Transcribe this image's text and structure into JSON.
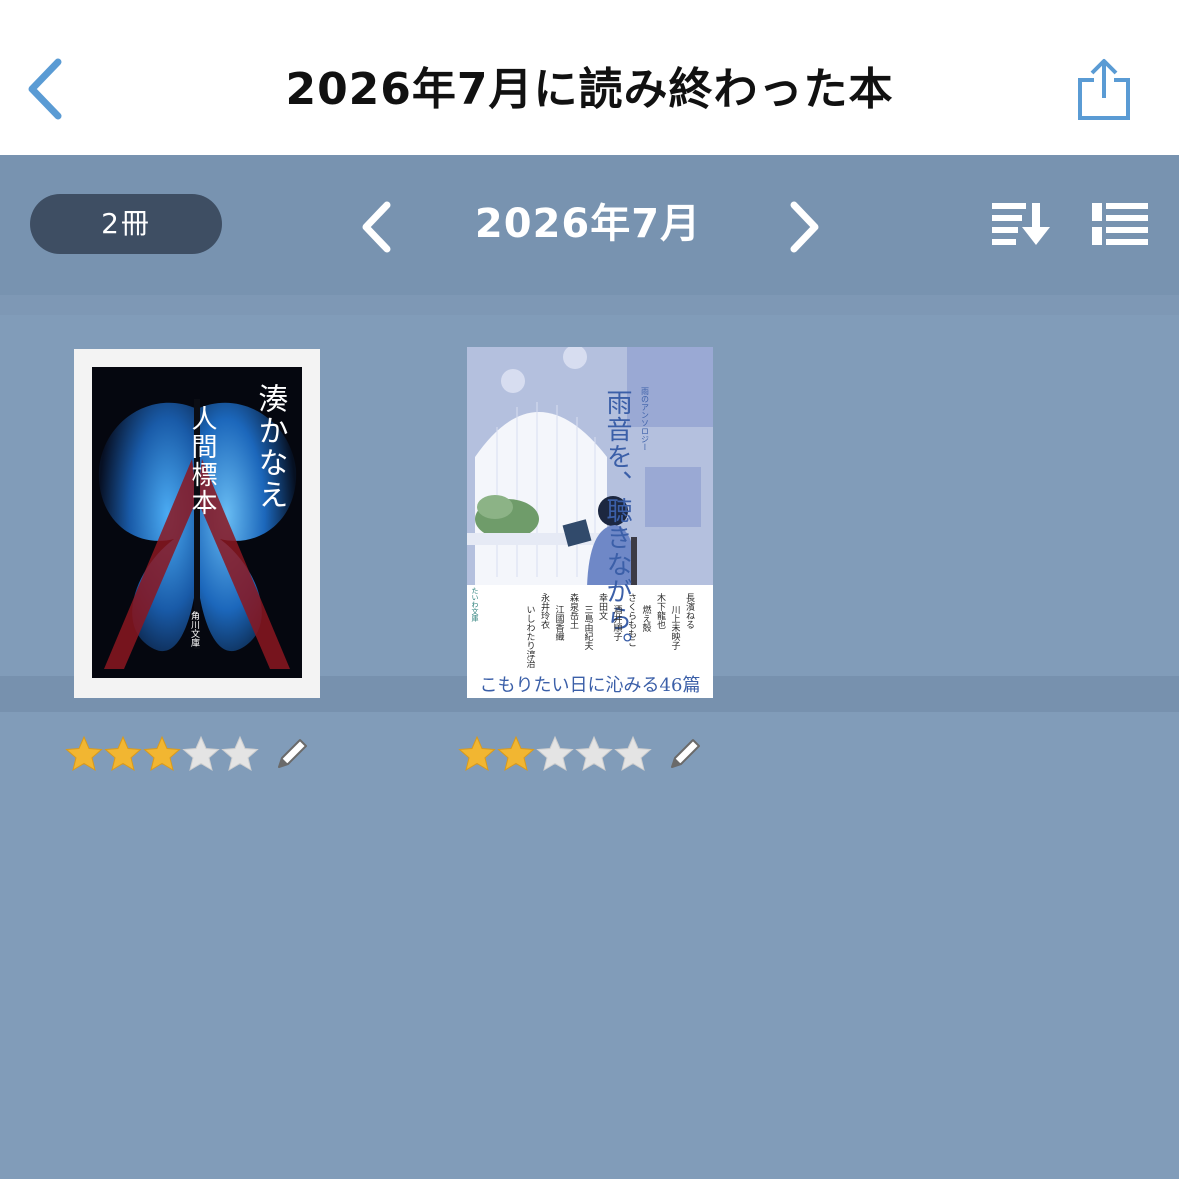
{
  "nav": {
    "title": "2026年7月に読み終わった本",
    "back_icon": "chevron-left-icon",
    "share_icon": "share-icon",
    "accent_color": "#5a9bd4"
  },
  "toolbar": {
    "count_label": "2冊",
    "month_label": "2026年7月",
    "prev_icon": "chevron-left-icon",
    "next_icon": "chevron-right-icon",
    "sort_icon": "sort-descending-icon",
    "view_icon": "list-view-icon"
  },
  "books": [
    {
      "author": "湊かなえ",
      "title": "人間標本",
      "publisher": "角川文庫",
      "rating": 3,
      "max_rating": 5
    },
    {
      "title": "雨音を、聴きながら。",
      "series": "雨のアンソロジー",
      "label": "たいわ文庫",
      "tagline": "こもりたい日に沁みる46篇",
      "authors": [
        "長濱ねる",
        "川上未映子",
        "木下龍也",
        "燃え殻",
        "さくらももこ",
        "酒井順子",
        "幸田文",
        "三島由紀夫",
        "森泉岳土",
        "江國香織",
        "永井玲衣",
        "いしわたり淳治"
      ],
      "rating": 2,
      "max_rating": 5
    }
  ],
  "colors": {
    "background": "#819cb9",
    "toolbar": "#7893b0",
    "pill": "#3e4e63",
    "star_filled": "#f2b631",
    "star_empty": "#e4e4e4"
  }
}
